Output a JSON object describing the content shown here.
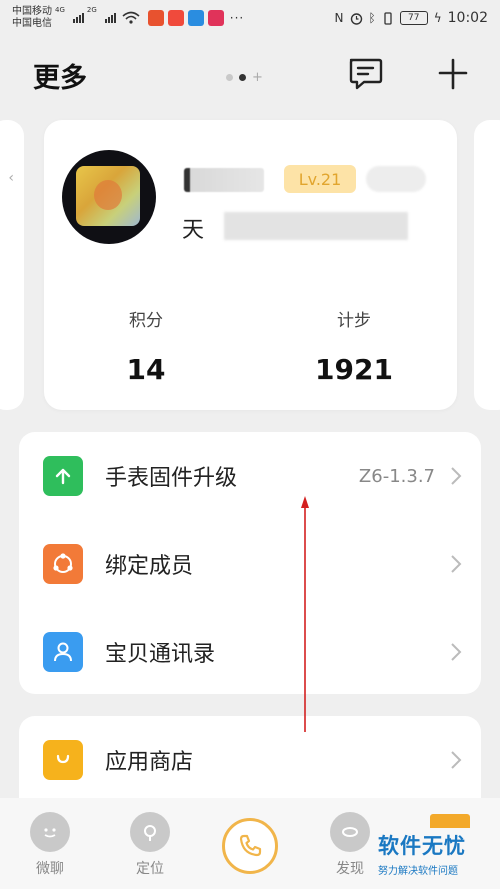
{
  "status_bar": {
    "carrier1": "中国移动",
    "carrier2": "中国电信",
    "net1": "4G",
    "net2": "2G",
    "more": "···",
    "battery": "77",
    "time": "10:02"
  },
  "header": {
    "title": "更多"
  },
  "profile": {
    "level": "Lv.21",
    "sub_text_visible": "天",
    "points_label": "积分",
    "points_value": "14",
    "steps_label": "计步",
    "steps_value": "1921"
  },
  "menu": {
    "items": [
      {
        "label": "手表固件升级",
        "value": "Z6-1.3.7",
        "icon": "upgrade-arrow-icon",
        "color": "#2fbe5c"
      },
      {
        "label": "绑定成员",
        "value": "",
        "icon": "share-members-icon",
        "color": "#f27a38"
      },
      {
        "label": "宝贝通讯录",
        "value": "",
        "icon": "contact-person-icon",
        "color": "#3a9cf0"
      }
    ],
    "store": {
      "label": "应用商店",
      "icon": "shopping-bag-icon",
      "color": "#f6b21c"
    }
  },
  "tabs": {
    "chat": "微聊",
    "locate": "定位",
    "find": "发现"
  },
  "watermark": {
    "main": "软件无忧",
    "sub": "努力解决软件问题"
  },
  "colors": {
    "accent": "#f1b54a",
    "level_bg": "#fde3a7",
    "level_text": "#e1a52e",
    "annotation": "#d32020"
  }
}
